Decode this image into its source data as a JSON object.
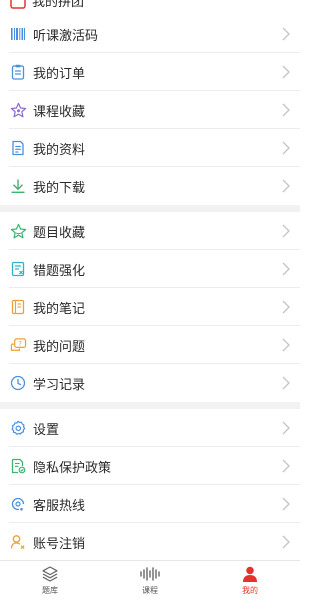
{
  "menu": {
    "clipped_label": "我的拼团",
    "group1": [
      {
        "label": "听课激活码",
        "icon": "barcode-icon"
      },
      {
        "label": "我的订单",
        "icon": "clipboard-icon"
      },
      {
        "label": "课程收藏",
        "icon": "star-icon"
      },
      {
        "label": "我的资料",
        "icon": "document-icon"
      },
      {
        "label": "我的下载",
        "icon": "download-icon"
      }
    ],
    "group2": [
      {
        "label": "题目收藏",
        "icon": "star-icon"
      },
      {
        "label": "错题强化",
        "icon": "error-book-icon"
      },
      {
        "label": "我的笔记",
        "icon": "notebook-icon"
      },
      {
        "label": "我的问题",
        "icon": "question-bubble-icon"
      },
      {
        "label": "学习记录",
        "icon": "clock-icon"
      }
    ],
    "group3": [
      {
        "label": "设置",
        "icon": "gear-icon"
      },
      {
        "label": "隐私保护政策",
        "icon": "privacy-document-icon"
      },
      {
        "label": "客服热线",
        "icon": "customer-service-icon"
      },
      {
        "label": "账号注销",
        "icon": "user-remove-icon"
      }
    ]
  },
  "tabs": [
    {
      "label": "题库",
      "icon": "layers-icon",
      "active": false
    },
    {
      "label": "课程",
      "icon": "audio-wave-icon",
      "active": false
    },
    {
      "label": "我的",
      "icon": "user-icon",
      "active": true
    }
  ],
  "colors": {
    "accent": "#e5322d",
    "blue": "#4a90e2",
    "purple": "#8e6ad8",
    "green": "#3cb371",
    "orange": "#f0a030",
    "cyan": "#2bb5c8"
  }
}
